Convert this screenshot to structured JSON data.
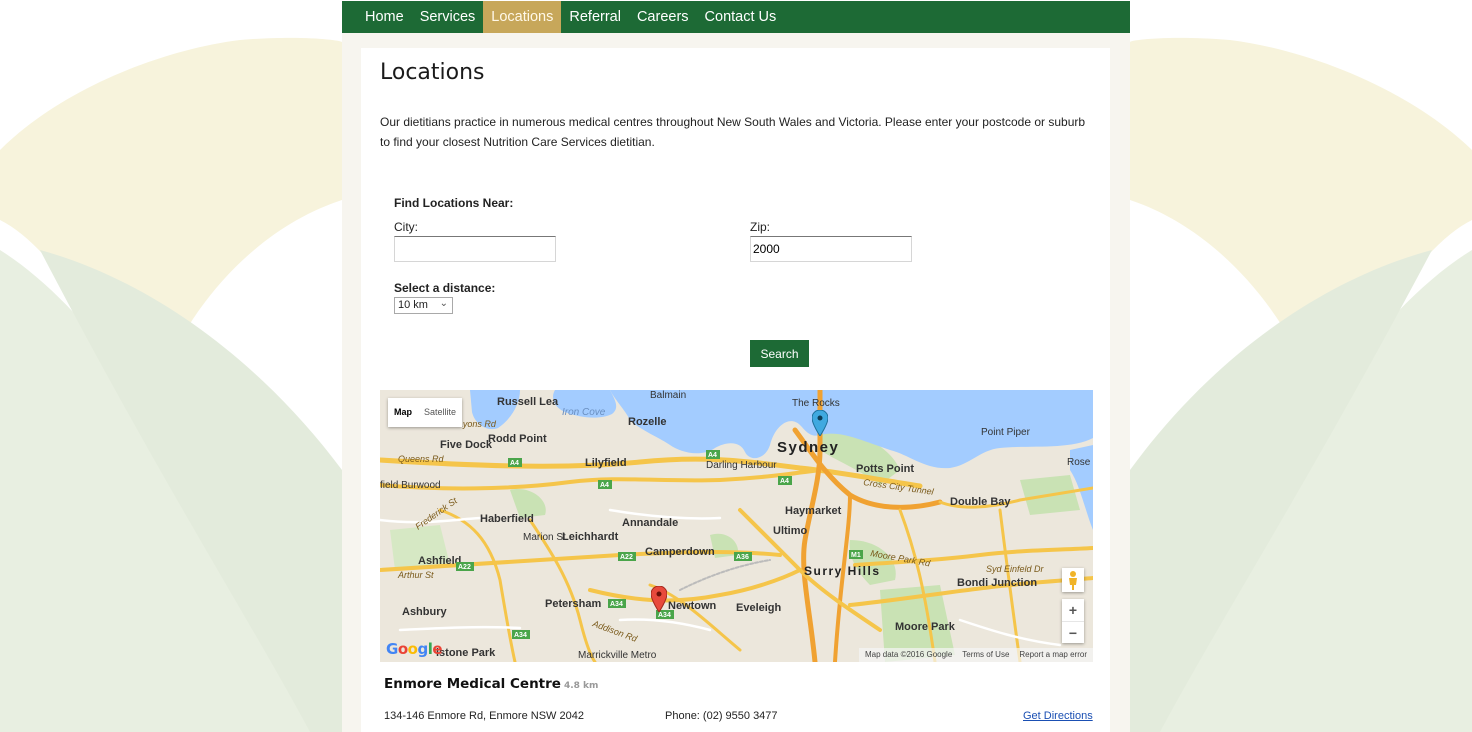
{
  "nav": {
    "items": [
      {
        "label": "Home"
      },
      {
        "label": "Services"
      },
      {
        "label": "Locations",
        "active": true
      },
      {
        "label": "Referral"
      },
      {
        "label": "Careers"
      },
      {
        "label": "Contact Us"
      }
    ]
  },
  "page": {
    "title": "Locations",
    "intro": "Our dietitians practice in numerous medical centres throughout New South Wales and Victoria. Please enter your postcode or suburb to find your closest Nutrition Care Services dietitian."
  },
  "search_form": {
    "heading": "Find Locations Near:",
    "city_label": "City:",
    "city_value": "",
    "zip_label": "Zip:",
    "zip_value": "2000",
    "distance_label": "Select a distance:",
    "distance_value": "10 km",
    "search_button": "Search"
  },
  "map": {
    "type_buttons": [
      "Map",
      "Satellite"
    ],
    "selected_type": "Map",
    "attribution": "Map data ©2016 Google",
    "terms": "Terms of Use",
    "report": "Report a map error",
    "logo": "Google",
    "zoom_in": "+",
    "zoom_out": "−",
    "labels": {
      "sydney": "Sydney",
      "the_rocks": "The Rocks",
      "russell_lea": "Russell Lea",
      "balmain": "Balmain",
      "iron_cove": "Iron Cove",
      "rozelle": "Rozelle",
      "five_dock": "Five Dock",
      "rodd_point": "Rodd Point",
      "lilyfield": "Lilyfield",
      "darling_harbour": "Darling Harbour",
      "potts_point": "Potts Point",
      "point_piper": "Point Piper",
      "rose": "Rose",
      "burwood": "field Burwood",
      "haberfield": "Haberfield",
      "annandale": "Annandale",
      "leichhardt": "Leichhardt",
      "haymarket": "Haymarket",
      "ultimo": "Ultimo",
      "double_bay": "Double Bay",
      "camperdown": "Camperdown",
      "surry_hills": "Surry Hills",
      "ashfield": "Ashfield",
      "bondi_junction": "Bondi Junction",
      "petersham": "Petersham",
      "newtown": "Newtown",
      "eveleigh": "Eveleigh",
      "ashbury": "Ashbury",
      "moore_park": "Moore Park",
      "marrickville_metro": "Marrickville Metro",
      "stone_park": "lstone Park",
      "queens_rd": "Queens Rd",
      "lyons_rd": "Lyons Rd",
      "frederick_st": "Frederick St",
      "cross_city_tunnel": "Cross City Tunnel",
      "moore_park_rd": "Moore Park Rd",
      "syd_einfeld_dr": "Syd Einfeld Dr",
      "arthur_st": "Arthur St",
      "addison_rd": "Addison Rd",
      "marion_st": "Marion St"
    },
    "shields": [
      "A4",
      "A4",
      "A4",
      "A4",
      "A22",
      "A36",
      "A22",
      "A34",
      "A34",
      "A34",
      "M1"
    ]
  },
  "result": {
    "name": "Enmore Medical Centre",
    "distance": "4.8 km",
    "address": "134-146 Enmore Rd, Enmore NSW 2042",
    "phone": "Phone: (02) 9550 3477",
    "directions": "Get Directions"
  },
  "colors": {
    "nav_bg": "#1d6a35",
    "nav_active": "#c7a75a",
    "button": "#1d6a35",
    "deco_leaf": "#e6eee0",
    "deco_cream": "#f7f3dc"
  }
}
